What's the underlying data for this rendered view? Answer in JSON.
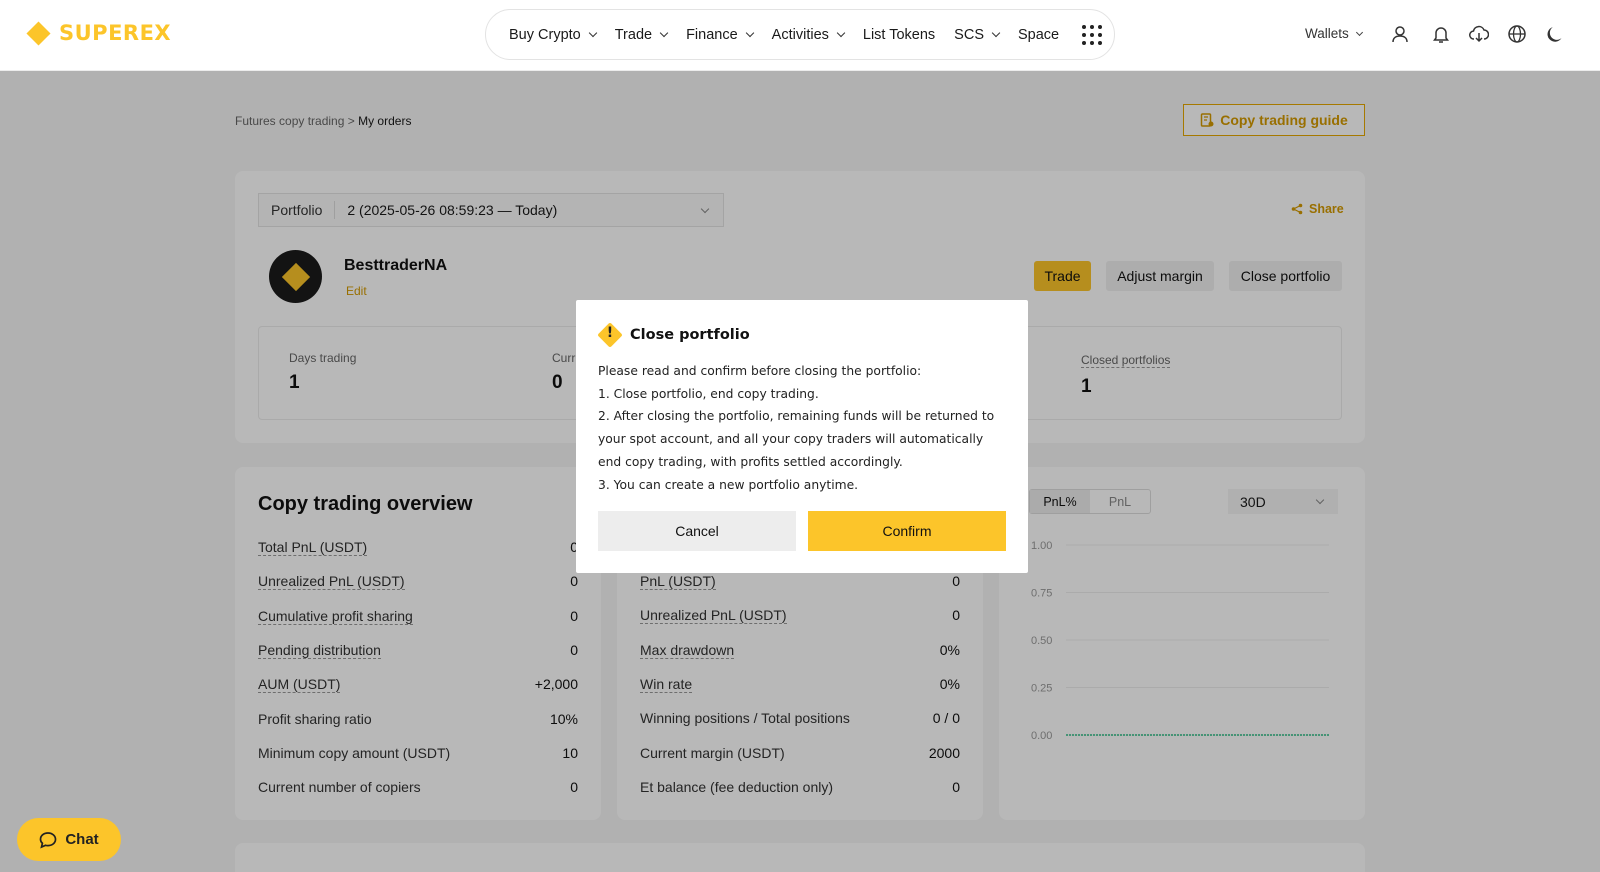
{
  "brand": {
    "name": "SUPEREX",
    "accent": "#fcc52a"
  },
  "nav": {
    "items": [
      {
        "label": "Buy Crypto",
        "dropdown": true
      },
      {
        "label": "Trade",
        "dropdown": true
      },
      {
        "label": "Finance",
        "dropdown": true
      },
      {
        "label": "Activities",
        "dropdown": true
      },
      {
        "label": "List Tokens",
        "dropdown": false
      },
      {
        "label": "SCS",
        "dropdown": true
      },
      {
        "label": "Space",
        "dropdown": false
      }
    ],
    "wallets": "Wallets",
    "icons": [
      "user-icon",
      "bell-icon",
      "download-icon",
      "globe-icon",
      "moon-icon"
    ]
  },
  "breadcrumb": {
    "parent": "Futures copy trading",
    "separator": ">",
    "current": "My orders"
  },
  "guide_button": "Copy trading guide",
  "portfolio": {
    "select_label": "Portfolio",
    "select_value": "2  (2025-05-26 08:59:23 — Today)",
    "share": "Share",
    "trader_name": "BesttraderNA",
    "edit": "Edit",
    "buttons": {
      "trade": "Trade",
      "adjust": "Adjust margin",
      "close": "Close portfolio"
    },
    "stats": [
      {
        "label": "Days trading",
        "value": "1"
      },
      {
        "label": "Curr",
        "value": "0"
      },
      {
        "label": "Closed portfolios",
        "value": "1"
      }
    ]
  },
  "overview": {
    "title": "Copy trading overview",
    "left_rows": [
      {
        "label": "Total PnL (USDT)",
        "value": "0"
      },
      {
        "label": "Unrealized PnL (USDT)",
        "value": "0"
      },
      {
        "label": "Cumulative profit sharing",
        "value": "0"
      },
      {
        "label": "Pending distribution",
        "value": "0"
      },
      {
        "label": "AUM (USDT)",
        "value": "+2,000"
      },
      {
        "label": "Profit sharing ratio",
        "value": "10%"
      },
      {
        "label": "Minimum copy amount (USDT)",
        "value": "10"
      },
      {
        "label": "Current number of copiers",
        "value": "0"
      }
    ],
    "mid_rows": [
      {
        "label": "PnL (USDT)",
        "value": "0"
      },
      {
        "label": "Unrealized PnL (USDT)",
        "value": "0"
      },
      {
        "label": "Max drawdown",
        "value": "0%"
      },
      {
        "label": "Win rate",
        "value": "0%"
      },
      {
        "label": "Winning positions / Total positions",
        "value": "0 / 0"
      },
      {
        "label": "Current margin (USDT)",
        "value": "2000"
      },
      {
        "label": "Et balance (fee deduction only)",
        "value": "0"
      }
    ],
    "chart_tabs": [
      "PnL%",
      "PnL"
    ],
    "range": "30D"
  },
  "chart_data": {
    "type": "line",
    "series": [
      {
        "values": [
          0,
          0
        ]
      }
    ],
    "yticks": [
      "1.00",
      "0.75",
      "0.50",
      "0.25",
      "0.00"
    ],
    "ylim": [
      0,
      1
    ],
    "color": "#2ebd85",
    "grid": true
  },
  "chat": "Chat",
  "modal": {
    "title": "Close portfolio",
    "intro": "Please read and confirm before closing the portfolio:",
    "points": [
      "1. Close portfolio, end copy trading.",
      "2. After closing the portfolio, remaining funds will be returned to your spot account, and all your copy traders will automatically end copy trading, with profits settled accordingly.",
      "3. You can create a new portfolio anytime."
    ],
    "cancel": "Cancel",
    "confirm": "Confirm"
  }
}
